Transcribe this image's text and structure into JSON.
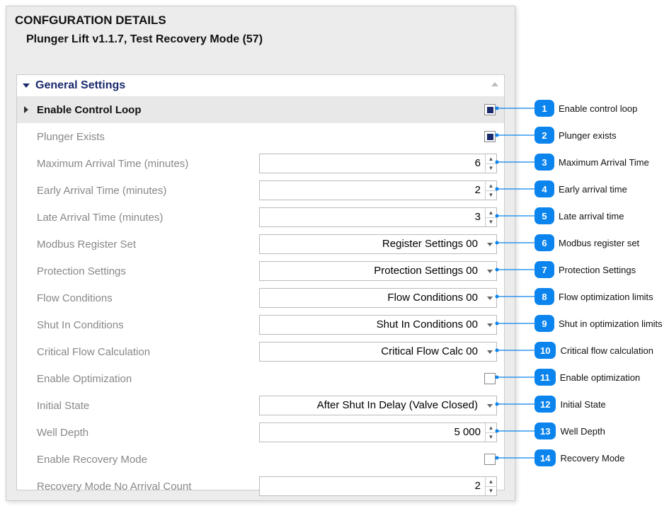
{
  "panel": {
    "title": "CONFGURATION DETAILS",
    "subtitle": "Plunger Lift v1.1.7, Test Recovery Mode (57)"
  },
  "section": {
    "title": "General Settings"
  },
  "rows": [
    {
      "label": "Enable Control Loop",
      "type": "checkbox",
      "checked": true,
      "selected": true,
      "mark": true
    },
    {
      "label": "Plunger Exists",
      "type": "checkbox",
      "checked": true,
      "dim": true
    },
    {
      "label": "Maximum Arrival Time (minutes)",
      "type": "spinner",
      "value": "6",
      "dim": true
    },
    {
      "label": "Early Arrival Time (minutes)",
      "type": "spinner",
      "value": "2",
      "dim": true
    },
    {
      "label": "Late Arrival Time (minutes)",
      "type": "spinner",
      "value": "3",
      "dim": true
    },
    {
      "label": "Modbus Register Set",
      "type": "dropdown",
      "value": "Register Settings 00",
      "dim": true
    },
    {
      "label": "Protection Settings",
      "type": "dropdown",
      "value": "Protection Settings 00",
      "dim": true
    },
    {
      "label": "Flow Conditions",
      "type": "dropdown",
      "value": "Flow Conditions 00",
      "dim": true
    },
    {
      "label": "Shut In Conditions",
      "type": "dropdown",
      "value": "Shut In Conditions 00",
      "dim": true
    },
    {
      "label": "Critical Flow Calculation",
      "type": "dropdown",
      "value": "Critical Flow Calc 00",
      "dim": true
    },
    {
      "label": "Enable Optimization",
      "type": "checkbox",
      "checked": false,
      "dim": true
    },
    {
      "label": "Initial State",
      "type": "dropdown",
      "value": "After Shut In Delay (Valve Closed)",
      "dim": true
    },
    {
      "label": "Well Depth",
      "type": "spinner",
      "value": "5 000",
      "dim": true
    },
    {
      "label": "Enable Recovery Mode",
      "type": "checkbox",
      "checked": false,
      "dim": true
    },
    {
      "label": "Recovery Mode No Arrival Count",
      "type": "spinner",
      "value": "2",
      "dim": true
    }
  ],
  "callouts": [
    {
      "n": "1",
      "text": "Enable control loop"
    },
    {
      "n": "2",
      "text": "Plunger exists"
    },
    {
      "n": "3",
      "text": "Maximum Arrival Time"
    },
    {
      "n": "4",
      "text": "Early arrival time"
    },
    {
      "n": "5",
      "text": "Late arrival time"
    },
    {
      "n": "6",
      "text": "Modbus register set"
    },
    {
      "n": "7",
      "text": "Protection Settings"
    },
    {
      "n": "8",
      "text": "Flow optimization limits"
    },
    {
      "n": "9",
      "text": "Shut in optimization limits"
    },
    {
      "n": "10",
      "text": "Critical flow calculation"
    },
    {
      "n": "11",
      "text": "Enable optimization"
    },
    {
      "n": "12",
      "text": "Initial State"
    },
    {
      "n": "13",
      "text": "Well Depth"
    },
    {
      "n": "14",
      "text": "Recovery Mode"
    }
  ]
}
